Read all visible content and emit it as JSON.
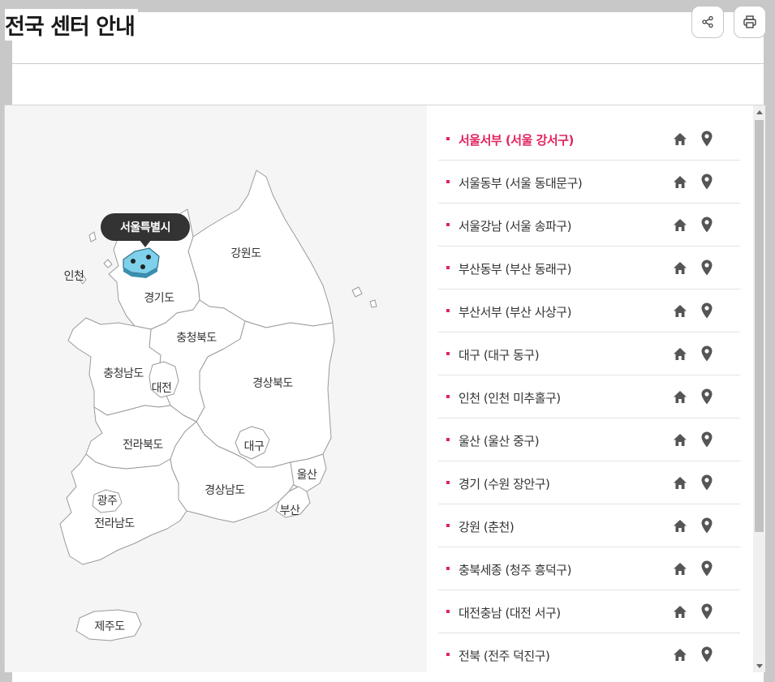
{
  "page_title": "전국 센터 안내",
  "header_actions": {
    "share_icon": "share-icon",
    "print_icon": "print-icon"
  },
  "map": {
    "selected_region": "서울특별시",
    "labels": {
      "incheon": "인천",
      "gyeonggi": "경기도",
      "gangwon": "강원도",
      "chungbuk": "충청북도",
      "chungnam": "충청남도",
      "daejeon": "대전",
      "gyeongbuk": "경상북도",
      "daegu": "대구",
      "jeonbuk": "전라북도",
      "ulsan": "울산",
      "gyeongnam": "경상남도",
      "gwangju": "광주",
      "busan": "부산",
      "jeonnam": "전라남도",
      "jeju": "제주도"
    }
  },
  "centers": [
    {
      "name": "서울서부 (서울 강서구)",
      "active": true
    },
    {
      "name": "서울동부 (서울 동대문구)"
    },
    {
      "name": "서울강남 (서울 송파구)"
    },
    {
      "name": "부산동부 (부산 동래구)"
    },
    {
      "name": "부산서부 (부산 사상구)"
    },
    {
      "name": "대구 (대구 동구)"
    },
    {
      "name": "인천 (인천 미추홀구)"
    },
    {
      "name": "울산 (울산 중구)"
    },
    {
      "name": "경기 (수원 장안구)"
    },
    {
      "name": "강원 (춘천)"
    },
    {
      "name": "충북세종 (청주 흥덕구)"
    },
    {
      "name": "대전충남 (대전 서구)"
    },
    {
      "name": "전북 (전주 덕진구)"
    }
  ],
  "colors": {
    "accent": "#e0245e",
    "icon": "#555555",
    "seoul_fill": "#7fd0ea"
  }
}
